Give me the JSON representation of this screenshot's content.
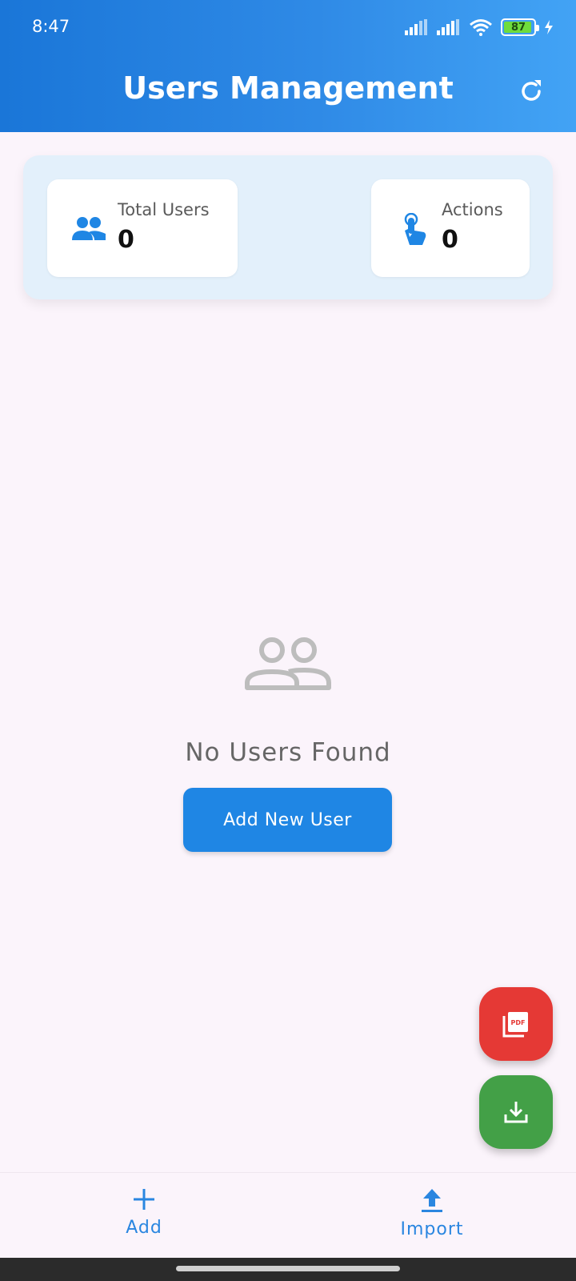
{
  "status_bar": {
    "time": "8:47",
    "battery": "87"
  },
  "header": {
    "title": "Users Management",
    "refresh_icon": "refresh-icon"
  },
  "summary": {
    "total_users": {
      "label": "Total Users",
      "value": "0",
      "icon": "group-icon"
    },
    "actions": {
      "label": "Actions",
      "value": "0",
      "icon": "touch-icon"
    }
  },
  "empty_state": {
    "icon": "people-outline-icon",
    "message": "No Users Found",
    "button_label": "Add New User"
  },
  "fabs": {
    "pdf_icon": "pdf-icon",
    "download_icon": "download-icon"
  },
  "bottom_nav": {
    "add_label": "Add",
    "import_label": "Import"
  },
  "colors": {
    "header_start": "#1a76d8",
    "header_end": "#42a3f5",
    "primary": "#1f86e4",
    "pdf_fab": "#e53935",
    "download_fab": "#43a047",
    "background": "#fbf4fb",
    "summary_panel": "#e3f0fb"
  }
}
